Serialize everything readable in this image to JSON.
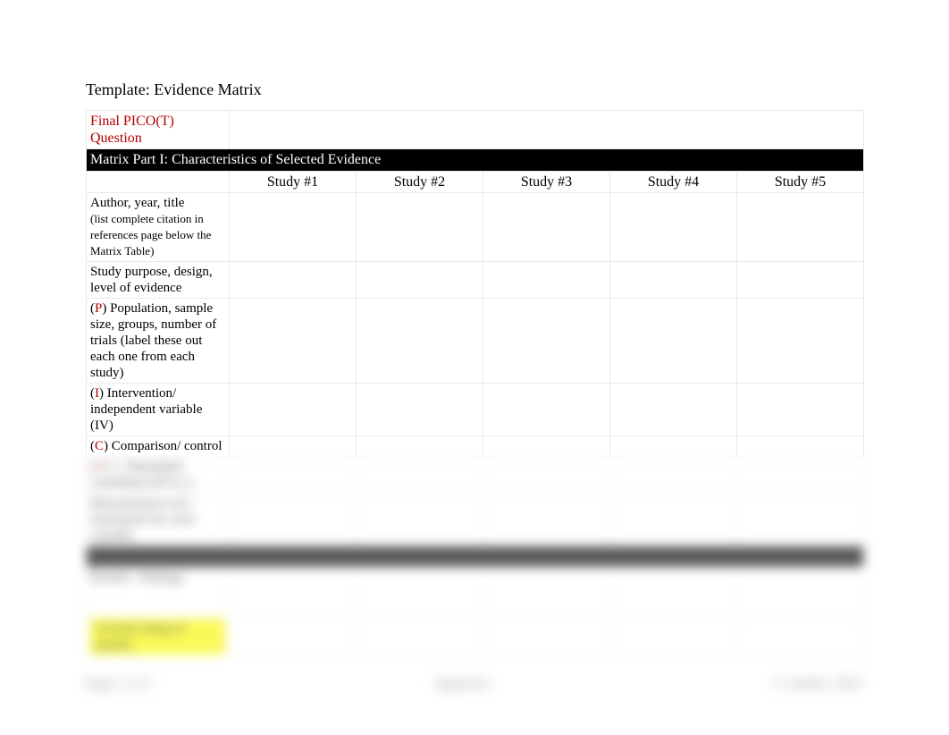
{
  "doc": {
    "title": "Template: Evidence Matrix"
  },
  "pico_header": {
    "line1": "Final PICO(T)",
    "line2": "Question"
  },
  "section1": "Matrix Part I: Characteristics of Selected Evidence",
  "columns": {
    "c0": "",
    "c1": "Study #1",
    "c2": "Study #2",
    "c3": "Study #3",
    "c4": "Study #4",
    "c5": "Study #5"
  },
  "rows": {
    "r1": {
      "main": "Author, year, title",
      "sub": "(list complete citation in references page below the Matrix Table)"
    },
    "r2": {
      "main": "Study purpose, design, level of evidence"
    },
    "r3": {
      "prefix_open": "(",
      "letter": "P",
      "prefix_close": ")",
      "main": " Population, sample size, groups, number of trials (label these out each one from each study)"
    },
    "r4": {
      "prefix_open": "(",
      "letter": "I",
      "prefix_close": ")",
      "main": " Intervention/ independent variable (IV)"
    },
    "r5": {
      "prefix_open": "(",
      "letter": "C",
      "prefix_close": ")",
      "main": " Comparison/ control"
    },
    "r6": {
      "prefix_open": "(",
      "letter": "O",
      "prefix_close": ")",
      "main": " 1. Dependent variable(s) (DV); 2."
    },
    "r7_blur": "Measurement tool / instrument for each variable",
    "r8_blur": "Results / findings"
  },
  "section2_blur": "Matrix Part II: Critical Appraisal",
  "highlight_blur": "Overall rating of quality",
  "footer": {
    "left": "Page 1 of 2",
    "center": "Signature",
    "right": "© Author, 2021"
  }
}
